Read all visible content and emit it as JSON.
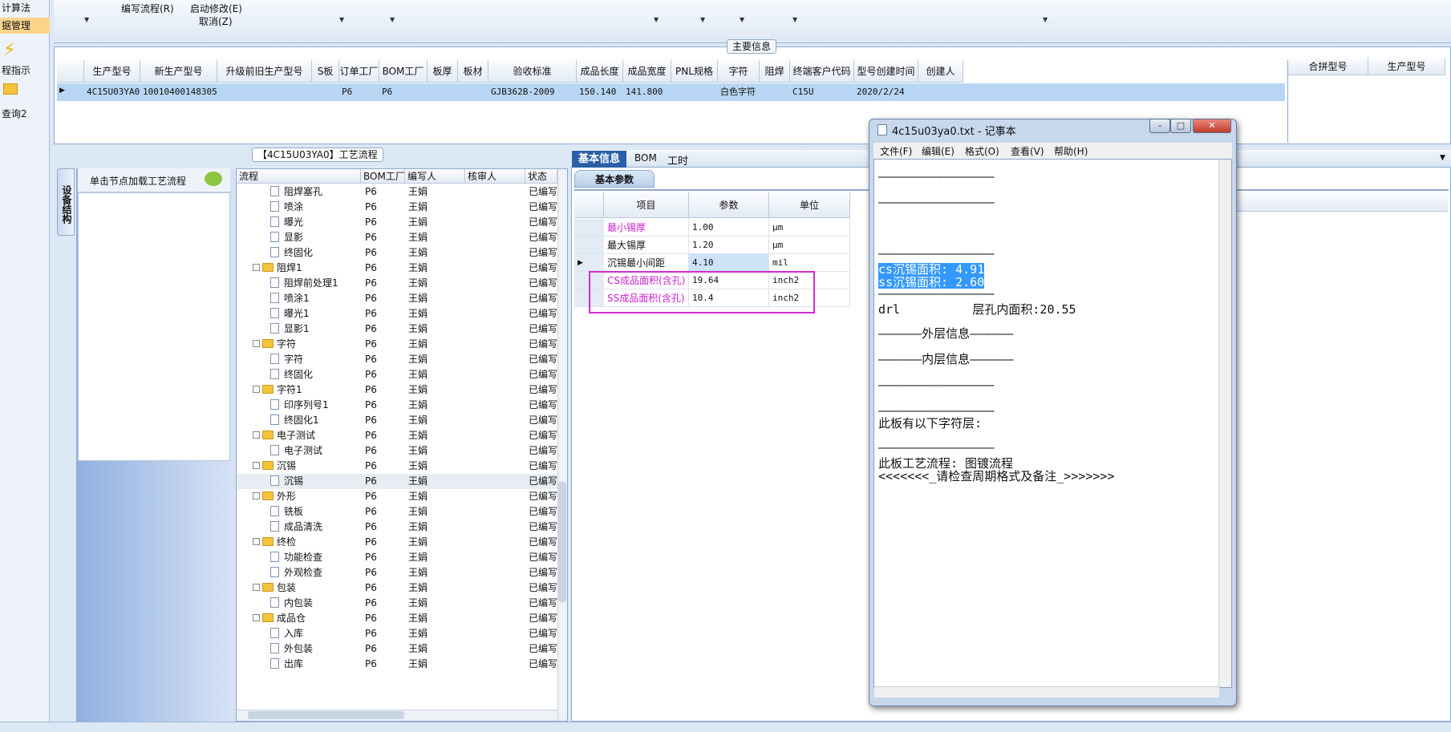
{
  "nav": {
    "items": [
      "计算法",
      "据管理",
      "程指示",
      "查询2"
    ]
  },
  "ribbon": {
    "write_flow": "编写流程(R)",
    "start_modify": "启动修改(E)",
    "cancel": "取消(Z)"
  },
  "main_info": {
    "group_title": "主要信息",
    "columns": [
      "生产型号",
      "新生产型号",
      "升级前旧生产型号",
      "S板",
      "订单工厂",
      "BOM工厂",
      "板厚",
      "板材",
      "验收标准",
      "成品长度",
      "成品宽度",
      "PNL规格",
      "字符",
      "阻焊",
      "终端客户代码",
      "型号创建时间",
      "创建人"
    ],
    "row": [
      "4C15U03YA0",
      "10010400148305",
      "",
      "",
      "P6",
      "P6",
      "",
      "",
      "GJB362B-2009",
      "150.140",
      "141.800",
      "",
      "白色字符",
      "",
      "C15U",
      "2020/2/24",
      ""
    ],
    "side_columns": [
      "合拼型号",
      "生产型号"
    ]
  },
  "left_panel": {
    "vertical_tab": "设备结构",
    "hint": "单击节点加载工艺流程"
  },
  "tree": {
    "title": "【4C15U03YA0】工艺流程",
    "columns": [
      "流程",
      "BOM工厂",
      "编写人",
      "核审人",
      "状态"
    ],
    "rows": [
      {
        "name": "阻焊塞孔",
        "folder": false,
        "bom": "P6",
        "writer": "王娟",
        "status": "已编写"
      },
      {
        "name": "喷涂",
        "folder": false,
        "bom": "P6",
        "writer": "王娟",
        "status": "已编写"
      },
      {
        "name": "曝光",
        "folder": false,
        "bom": "P6",
        "writer": "王娟",
        "status": "已编写"
      },
      {
        "name": "显影",
        "folder": false,
        "bom": "P6",
        "writer": "王娟",
        "status": "已编写"
      },
      {
        "name": "终固化",
        "folder": false,
        "bom": "P6",
        "writer": "王娟",
        "status": "已编写"
      },
      {
        "name": "阻焊1",
        "folder": true,
        "bom": "P6",
        "writer": "王娟",
        "status": "已编写"
      },
      {
        "name": "阻焊前处理1",
        "folder": false,
        "bom": "P6",
        "writer": "王娟",
        "status": "已编写"
      },
      {
        "name": "喷涂1",
        "folder": false,
        "bom": "P6",
        "writer": "王娟",
        "status": "已编写"
      },
      {
        "name": "曝光1",
        "folder": false,
        "bom": "P6",
        "writer": "王娟",
        "status": "已编写"
      },
      {
        "name": "显影1",
        "folder": false,
        "bom": "P6",
        "writer": "王娟",
        "status": "已编写"
      },
      {
        "name": "字符",
        "folder": true,
        "bom": "P6",
        "writer": "王娟",
        "status": "已编写"
      },
      {
        "name": "字符",
        "folder": false,
        "bom": "P6",
        "writer": "王娟",
        "status": "已编写"
      },
      {
        "name": "终固化",
        "folder": false,
        "bom": "P6",
        "writer": "王娟",
        "status": "已编写"
      },
      {
        "name": "字符1",
        "folder": true,
        "bom": "P6",
        "writer": "王娟",
        "status": "已编写"
      },
      {
        "name": "印序列号1",
        "folder": false,
        "bom": "P6",
        "writer": "王娟",
        "status": "已编写"
      },
      {
        "name": "终固化1",
        "folder": false,
        "bom": "P6",
        "writer": "王娟",
        "status": "已编写"
      },
      {
        "name": "电子测试",
        "folder": true,
        "bom": "P6",
        "writer": "王娟",
        "status": "已编写"
      },
      {
        "name": "电子测试",
        "folder": false,
        "bom": "P6",
        "writer": "王娟",
        "status": "已编写"
      },
      {
        "name": "沉锡",
        "folder": true,
        "bom": "P6",
        "writer": "王娟",
        "status": "已编写"
      },
      {
        "name": "沉锡",
        "folder": false,
        "bom": "P6",
        "writer": "王娟",
        "status": "已编写"
      },
      {
        "name": "外形",
        "folder": true,
        "bom": "P6",
        "writer": "王娟",
        "status": "已编写"
      },
      {
        "name": "铣板",
        "folder": false,
        "bom": "P6",
        "writer": "王娟",
        "status": "已编写"
      },
      {
        "name": "成品清洗",
        "folder": false,
        "bom": "P6",
        "writer": "王娟",
        "status": "已编写"
      },
      {
        "name": "终检",
        "folder": true,
        "bom": "P6",
        "writer": "王娟",
        "status": "已编写"
      },
      {
        "name": "功能检查",
        "folder": false,
        "bom": "P6",
        "writer": "王娟",
        "status": "已编写"
      },
      {
        "name": "外观检查",
        "folder": false,
        "bom": "P6",
        "writer": "王娟",
        "status": "已编写"
      },
      {
        "name": "包装",
        "folder": true,
        "bom": "P6",
        "writer": "王娟",
        "status": "已编写"
      },
      {
        "name": "内包装",
        "folder": false,
        "bom": "P6",
        "writer": "王娟",
        "status": "已编写"
      },
      {
        "name": "成品仓",
        "folder": true,
        "bom": "P6",
        "writer": "王娟",
        "status": "已编写"
      },
      {
        "name": "入库",
        "folder": false,
        "bom": "P6",
        "writer": "王娟",
        "status": "已编写"
      },
      {
        "name": "外包装",
        "folder": false,
        "bom": "P6",
        "writer": "王娟",
        "status": "已编写"
      },
      {
        "name": "出库",
        "folder": false,
        "bom": "P6",
        "writer": "王娟",
        "status": "已编写"
      }
    ]
  },
  "tabs": [
    "基本信息",
    "BOM",
    "工时"
  ],
  "subtab": "基本参数",
  "params": {
    "columns": [
      "项目",
      "参数",
      "单位"
    ],
    "rows": [
      {
        "item": "最小锡厚",
        "value": "1.00",
        "unit": "μm",
        "pink": true
      },
      {
        "item": "最大锡厚",
        "value": "1.20",
        "unit": "μm",
        "pink": false
      },
      {
        "item": "沉锡最小间距",
        "value": "4.10",
        "unit": "mil",
        "pink": false
      },
      {
        "item": "CS成品面积(含孔)",
        "value": "19.64",
        "unit": "inch2",
        "pink": true
      },
      {
        "item": "SS成品面积(含孔)",
        "value": "10.4",
        "unit": "inch2",
        "pink": true
      }
    ]
  },
  "notepad": {
    "title": "4c15u03ya0.txt - 记事本",
    "menu": [
      "文件(F)",
      "编辑(E)",
      "格式(O)",
      "查看(V)",
      "帮助(H)"
    ],
    "lines": [
      {
        "text": "————————————————",
        "hl": false
      },
      {
        "text": "————————————————",
        "hl": false
      },
      {
        "text": "",
        "hl": false
      },
      {
        "text": "————————————————",
        "hl": false
      },
      {
        "text": "cs沉锡面积: 4.91",
        "hl": true
      },
      {
        "text": "ss沉锡面积: 2.60",
        "hl": true
      },
      {
        "text": "————————————————",
        "hl": false
      },
      {
        "text": "drl          层孔内面积:20.55",
        "hl": false
      },
      {
        "text": "——————外层信息——————",
        "hl": false
      },
      {
        "text": "——————内层信息——————",
        "hl": false
      },
      {
        "text": "————————————————",
        "hl": false
      },
      {
        "text": "————————————————",
        "hl": false
      },
      {
        "text": "此板有以下字符层:",
        "hl": false
      },
      {
        "text": "————————————————",
        "hl": false
      },
      {
        "text": "此板工艺流程: 图镀流程",
        "hl": false
      },
      {
        "text": "<<<<<<<_请检查周期格式及备注_>>>>>>>",
        "hl": false
      }
    ]
  },
  "colors": {
    "accent": "#2a5fa8",
    "selection": "#b8d6f3",
    "highlight": "#3399ff",
    "pink": "#cc22cc"
  }
}
